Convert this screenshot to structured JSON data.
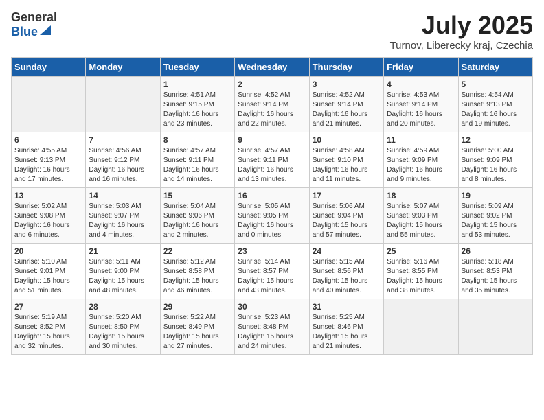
{
  "header": {
    "logo": {
      "general": "General",
      "blue": "Blue"
    },
    "title": "July 2025",
    "subtitle": "Turnov, Liberecky kraj, Czechia"
  },
  "calendar": {
    "days_of_week": [
      "Sunday",
      "Monday",
      "Tuesday",
      "Wednesday",
      "Thursday",
      "Friday",
      "Saturday"
    ],
    "weeks": [
      [
        {
          "day": "",
          "info": ""
        },
        {
          "day": "",
          "info": ""
        },
        {
          "day": "1",
          "info": "Sunrise: 4:51 AM\nSunset: 9:15 PM\nDaylight: 16 hours\nand 23 minutes."
        },
        {
          "day": "2",
          "info": "Sunrise: 4:52 AM\nSunset: 9:14 PM\nDaylight: 16 hours\nand 22 minutes."
        },
        {
          "day": "3",
          "info": "Sunrise: 4:52 AM\nSunset: 9:14 PM\nDaylight: 16 hours\nand 21 minutes."
        },
        {
          "day": "4",
          "info": "Sunrise: 4:53 AM\nSunset: 9:14 PM\nDaylight: 16 hours\nand 20 minutes."
        },
        {
          "day": "5",
          "info": "Sunrise: 4:54 AM\nSunset: 9:13 PM\nDaylight: 16 hours\nand 19 minutes."
        }
      ],
      [
        {
          "day": "6",
          "info": "Sunrise: 4:55 AM\nSunset: 9:13 PM\nDaylight: 16 hours\nand 17 minutes."
        },
        {
          "day": "7",
          "info": "Sunrise: 4:56 AM\nSunset: 9:12 PM\nDaylight: 16 hours\nand 16 minutes."
        },
        {
          "day": "8",
          "info": "Sunrise: 4:57 AM\nSunset: 9:11 PM\nDaylight: 16 hours\nand 14 minutes."
        },
        {
          "day": "9",
          "info": "Sunrise: 4:57 AM\nSunset: 9:11 PM\nDaylight: 16 hours\nand 13 minutes."
        },
        {
          "day": "10",
          "info": "Sunrise: 4:58 AM\nSunset: 9:10 PM\nDaylight: 16 hours\nand 11 minutes."
        },
        {
          "day": "11",
          "info": "Sunrise: 4:59 AM\nSunset: 9:09 PM\nDaylight: 16 hours\nand 9 minutes."
        },
        {
          "day": "12",
          "info": "Sunrise: 5:00 AM\nSunset: 9:09 PM\nDaylight: 16 hours\nand 8 minutes."
        }
      ],
      [
        {
          "day": "13",
          "info": "Sunrise: 5:02 AM\nSunset: 9:08 PM\nDaylight: 16 hours\nand 6 minutes."
        },
        {
          "day": "14",
          "info": "Sunrise: 5:03 AM\nSunset: 9:07 PM\nDaylight: 16 hours\nand 4 minutes."
        },
        {
          "day": "15",
          "info": "Sunrise: 5:04 AM\nSunset: 9:06 PM\nDaylight: 16 hours\nand 2 minutes."
        },
        {
          "day": "16",
          "info": "Sunrise: 5:05 AM\nSunset: 9:05 PM\nDaylight: 16 hours\nand 0 minutes."
        },
        {
          "day": "17",
          "info": "Sunrise: 5:06 AM\nSunset: 9:04 PM\nDaylight: 15 hours\nand 57 minutes."
        },
        {
          "day": "18",
          "info": "Sunrise: 5:07 AM\nSunset: 9:03 PM\nDaylight: 15 hours\nand 55 minutes."
        },
        {
          "day": "19",
          "info": "Sunrise: 5:09 AM\nSunset: 9:02 PM\nDaylight: 15 hours\nand 53 minutes."
        }
      ],
      [
        {
          "day": "20",
          "info": "Sunrise: 5:10 AM\nSunset: 9:01 PM\nDaylight: 15 hours\nand 51 minutes."
        },
        {
          "day": "21",
          "info": "Sunrise: 5:11 AM\nSunset: 9:00 PM\nDaylight: 15 hours\nand 48 minutes."
        },
        {
          "day": "22",
          "info": "Sunrise: 5:12 AM\nSunset: 8:58 PM\nDaylight: 15 hours\nand 46 minutes."
        },
        {
          "day": "23",
          "info": "Sunrise: 5:14 AM\nSunset: 8:57 PM\nDaylight: 15 hours\nand 43 minutes."
        },
        {
          "day": "24",
          "info": "Sunrise: 5:15 AM\nSunset: 8:56 PM\nDaylight: 15 hours\nand 40 minutes."
        },
        {
          "day": "25",
          "info": "Sunrise: 5:16 AM\nSunset: 8:55 PM\nDaylight: 15 hours\nand 38 minutes."
        },
        {
          "day": "26",
          "info": "Sunrise: 5:18 AM\nSunset: 8:53 PM\nDaylight: 15 hours\nand 35 minutes."
        }
      ],
      [
        {
          "day": "27",
          "info": "Sunrise: 5:19 AM\nSunset: 8:52 PM\nDaylight: 15 hours\nand 32 minutes."
        },
        {
          "day": "28",
          "info": "Sunrise: 5:20 AM\nSunset: 8:50 PM\nDaylight: 15 hours\nand 30 minutes."
        },
        {
          "day": "29",
          "info": "Sunrise: 5:22 AM\nSunset: 8:49 PM\nDaylight: 15 hours\nand 27 minutes."
        },
        {
          "day": "30",
          "info": "Sunrise: 5:23 AM\nSunset: 8:48 PM\nDaylight: 15 hours\nand 24 minutes."
        },
        {
          "day": "31",
          "info": "Sunrise: 5:25 AM\nSunset: 8:46 PM\nDaylight: 15 hours\nand 21 minutes."
        },
        {
          "day": "",
          "info": ""
        },
        {
          "day": "",
          "info": ""
        }
      ]
    ]
  }
}
